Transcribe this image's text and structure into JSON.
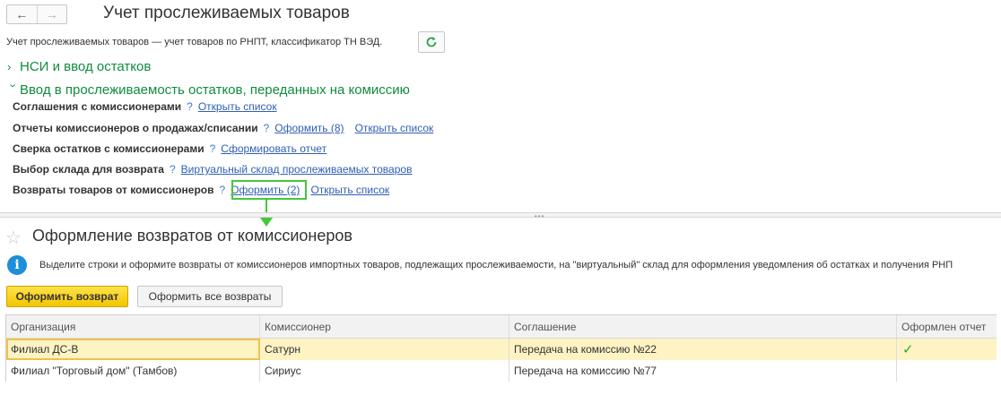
{
  "window": {
    "title": "Учет прослеживаемых товаров",
    "subtitle": "Учет прослеживаемых товаров — учет товаров по РНПТ, классификатор ТН ВЭД."
  },
  "groups": {
    "nsi": "НСИ и ввод остатков",
    "commission": "Ввод в прослеживаемость остатков, переданных на комиссию"
  },
  "rows": [
    {
      "label": "Соглашения с комиссионерами",
      "help": "?",
      "links": [
        "Открыть список"
      ]
    },
    {
      "label": "Отчеты комиссионеров о продажах/списании",
      "help": "?",
      "links": [
        "Оформить (8)",
        "Открыть список"
      ]
    },
    {
      "label": "Сверка остатков с комиссионерами",
      "help": "?",
      "links": [
        "Сформировать отчет"
      ]
    },
    {
      "label": "Выбор склада для возврата",
      "help": "?",
      "links": [
        "Виртуальный склад прослеживаемых товаров"
      ]
    },
    {
      "label": "Возвраты товаров от комиссионеров",
      "help": "?",
      "links": [
        "Оформить (2)",
        "Открыть список"
      ]
    }
  ],
  "subform": {
    "title": "Оформление возвратов от комиссионеров",
    "info": "Выделите строки и оформите возвраты от комиссионеров импортных товаров, подлежащих прослеживаемости, на \"виртуальный\" склад для оформления уведомления об остатках и получения РНП",
    "btn_primary": "Оформить возврат",
    "btn_secondary": "Оформить все возвраты"
  },
  "table": {
    "columns": [
      "Организация",
      "Комиссионер",
      "Соглашение",
      "Оформлен отчет"
    ],
    "rows": [
      [
        "Филиал ДС-В",
        "Сатурн",
        "Передача на комиссию №22",
        "✓"
      ],
      [
        "Филиал \"Торговый дом\" (Тамбов)",
        "Сириус",
        "Передача на комиссию №77",
        ""
      ]
    ]
  },
  "colors": {
    "group_green": "#0f8c3e",
    "link_blue": "#2f5fb3",
    "highlight_green": "#44c83a",
    "primary_yellow": "#f2c600"
  }
}
